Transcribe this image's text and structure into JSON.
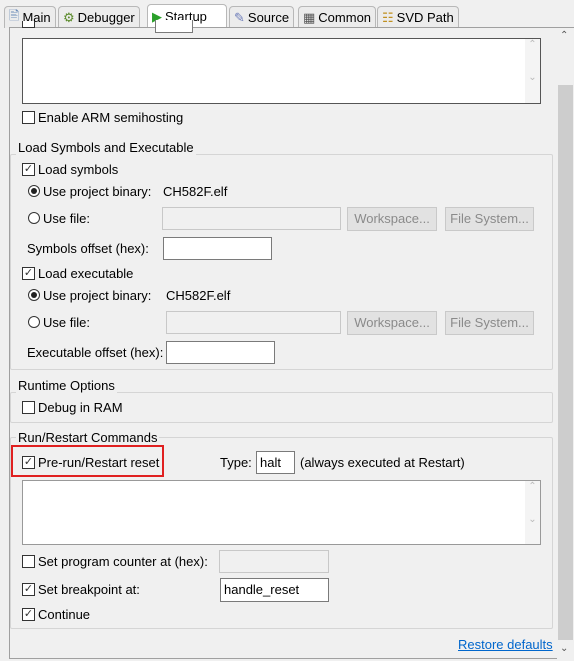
{
  "tabs": [
    {
      "label": "Main",
      "icon": "document-icon"
    },
    {
      "label": "Debugger",
      "icon": "bug-icon"
    },
    {
      "label": "Startup",
      "icon": "play-icon",
      "active": true
    },
    {
      "label": "Source",
      "icon": "source-icon"
    },
    {
      "label": "Common",
      "icon": "table-icon"
    },
    {
      "label": "SVD Path",
      "icon": "tree-icon"
    }
  ],
  "top": {
    "enable_arm_semihosting": "Enable ARM semihosting",
    "semihosting_checked": false
  },
  "load": {
    "title": "Load Symbols and Executable",
    "load_symbols": "Load symbols",
    "use_project_binary": "Use project binary:",
    "symbols_binary": "CH582F.elf",
    "use_file": "Use file:",
    "workspace": "Workspace...",
    "file_system": "File System...",
    "symbols_offset": "Symbols offset (hex):",
    "symbols_offset_value": "",
    "load_executable": "Load executable",
    "exec_binary": "CH582F.elf",
    "exec_offset": "Executable offset (hex):",
    "exec_offset_value": ""
  },
  "runtime": {
    "title": "Runtime Options",
    "debug_in_ram": "Debug in RAM"
  },
  "run": {
    "title": "Run/Restart Commands",
    "pre_run_reset": "Pre-run/Restart reset",
    "type_label": "Type:",
    "type_value": "halt",
    "type_note": "(always executed at Restart)",
    "set_pc": "Set program counter at (hex):",
    "set_pc_value": "",
    "set_breakpoint": "Set breakpoint at:",
    "breakpoint_value": "handle_reset",
    "continue": "Continue"
  },
  "restore_defaults": "Restore defaults",
  "colors": {
    "highlight": "#e02020",
    "link": "#0066cc",
    "play": "#2aa02a"
  }
}
